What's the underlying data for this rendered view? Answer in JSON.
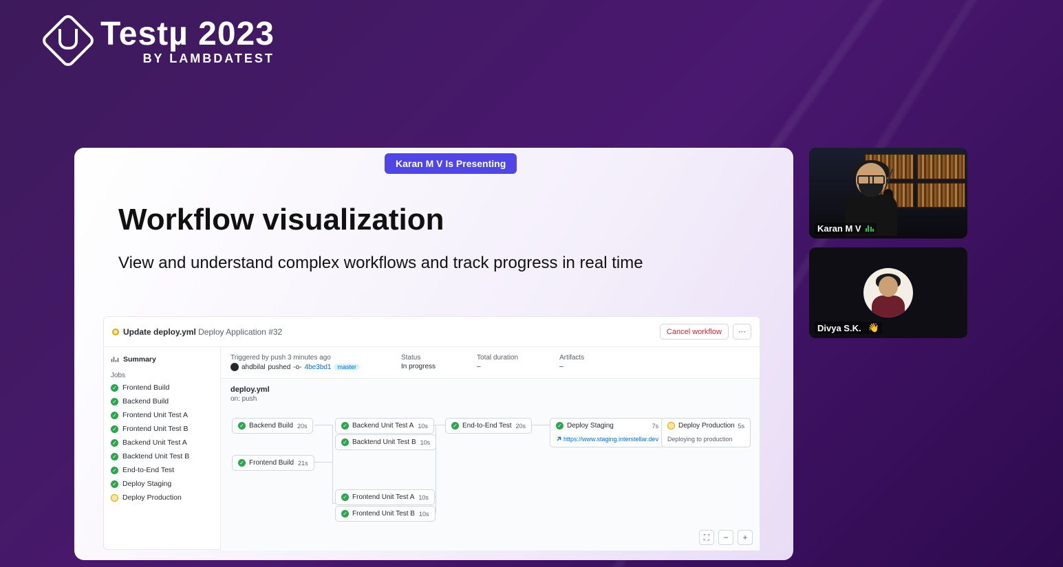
{
  "brand": {
    "title": "Testµ 2023",
    "subtitle": "BY LAMBDATEST"
  },
  "presenter_pill": "Karan M V Is Presenting",
  "slide": {
    "title": "Workflow visualization",
    "subtitle": "View and understand complex workflows and track progress in real time"
  },
  "gha": {
    "header": {
      "commit_msg": "Update deploy.yml",
      "run_name": "Deploy Application #32",
      "cancel_label": "Cancel workflow"
    },
    "sidebar": {
      "summary_label": "Summary",
      "jobs_label": "Jobs",
      "jobs": [
        {
          "name": "Frontend Build",
          "status": "success"
        },
        {
          "name": "Backend Build",
          "status": "success"
        },
        {
          "name": "Frontend Unit Test A",
          "status": "success"
        },
        {
          "name": "Frontend Unit Test B",
          "status": "success"
        },
        {
          "name": "Backend Unit Test A",
          "status": "success"
        },
        {
          "name": "Backtend Unit Test B",
          "status": "success"
        },
        {
          "name": "End-to-End Test",
          "status": "success"
        },
        {
          "name": "Deploy Staging",
          "status": "success"
        },
        {
          "name": "Deploy Production",
          "status": "pending"
        }
      ]
    },
    "meta": {
      "triggered_label": "Triggered by push 3 minutes ago",
      "actor": "ahdbilal",
      "action": "pushed",
      "commit_sha": "4be3bd1",
      "branch": "master",
      "status_label": "Status",
      "status_value": "In progress",
      "duration_label": "Total duration",
      "duration_value": "–",
      "artifacts_label": "Artifacts",
      "artifacts_value": "–"
    },
    "workflow": {
      "file": "deploy.yml",
      "on": "on: push",
      "nodes": {
        "backend_build": {
          "name": "Backend Build",
          "dur": "20s"
        },
        "frontend_build": {
          "name": "Frontend Build",
          "dur": "21s"
        },
        "backend_ut_a": {
          "name": "Backend Unit Test A",
          "dur": "10s"
        },
        "backend_ut_b": {
          "name": "Backtend Unit Test B",
          "dur": "10s"
        },
        "frontend_ut_a": {
          "name": "Frontend Unit Test A",
          "dur": "10s"
        },
        "frontend_ut_b": {
          "name": "Frontend Unit Test B",
          "dur": "10s"
        },
        "e2e": {
          "name": "End-to-End Test",
          "dur": "20s"
        },
        "staging": {
          "name": "Deploy Staging",
          "dur": "7s",
          "url": "https://www.staging.interstellar.dev"
        },
        "prod": {
          "name": "Deploy Production",
          "dur": "5s",
          "note": "Deploying to production"
        }
      }
    }
  },
  "participants": {
    "p1": "Karan M V",
    "p2": "Divya S.K.",
    "p2_emoji": "👋"
  }
}
